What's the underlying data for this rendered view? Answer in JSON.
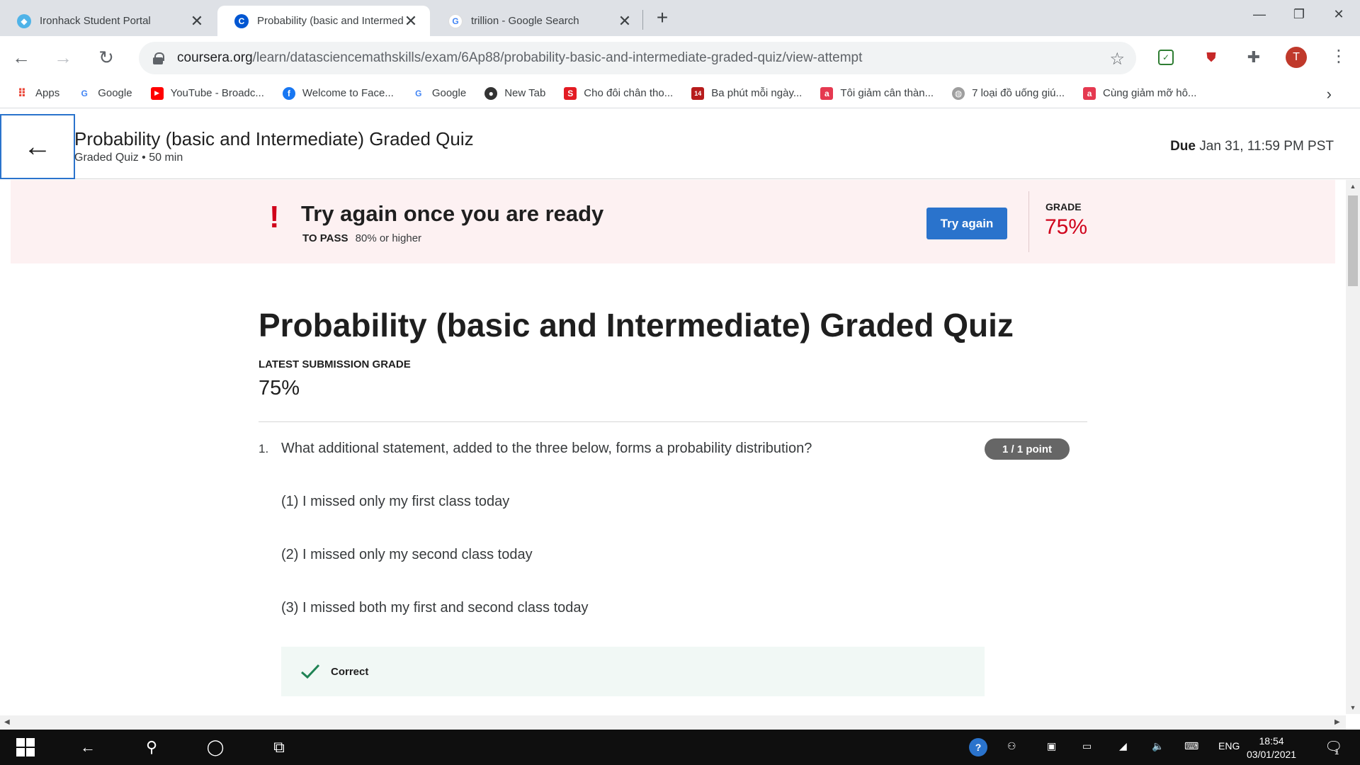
{
  "browser": {
    "tabs": [
      {
        "title": "Ironhack Student Portal",
        "active": false
      },
      {
        "title": "Probability (basic and Intermediate",
        "active": true
      },
      {
        "title": "trillion - Google Search",
        "active": false
      }
    ],
    "url_domain": "coursera.org",
    "url_path": "/learn/datasciencemathskills/exam/6Ap88/probability-basic-and-intermediate-graded-quiz/view-attempt",
    "profile_initial": "T"
  },
  "bookmarks": [
    {
      "label": "Apps",
      "icon": "apps-grid-icon"
    },
    {
      "label": "Google",
      "icon": "google-icon"
    },
    {
      "label": "YouTube - Broadc...",
      "icon": "youtube-icon"
    },
    {
      "label": "Welcome to Face...",
      "icon": "facebook-icon"
    },
    {
      "label": "Google",
      "icon": "google-icon"
    },
    {
      "label": "New Tab",
      "icon": "github-icon"
    },
    {
      "label": "Cho đôi chân tho...",
      "icon": "s-brand-icon"
    },
    {
      "label": "Ba phút mỗi ngày...",
      "icon": "calendar-14-icon"
    },
    {
      "label": "Tôi giảm cân thàn...",
      "icon": "a-brand-icon"
    },
    {
      "label": "7 loại đồ uống giú...",
      "icon": "globe-icon"
    },
    {
      "label": "Cùng giảm mỡ hô...",
      "icon": "a-brand-icon"
    }
  ],
  "header": {
    "title": "Probability (basic and Intermediate) Graded Quiz",
    "subtitle": "Graded Quiz • 50 min",
    "due_label": "Due",
    "due_value": "Jan 31, 11:59 PM PST"
  },
  "banner": {
    "message": "Try again once you are ready",
    "pass_label": "TO PASS",
    "pass_value": "80% or higher",
    "button_label": "Try again",
    "grade_label": "GRADE",
    "grade_value": "75%"
  },
  "main": {
    "title": "Probability (basic and Intermediate) Graded Quiz",
    "latest_grade_label": "LATEST SUBMISSION GRADE",
    "latest_grade_value": "75%",
    "question": {
      "number": "1.",
      "text": "What additional statement, added to the three below, forms a probability distribution?",
      "points": "1 / 1 point",
      "statements": [
        "(1) I missed only my first class today",
        "(2) I missed only my second class today",
        "(3) I missed both my first and second class today"
      ],
      "result": "Correct"
    }
  },
  "taskbar": {
    "language": "ENG",
    "time": "18:54",
    "date": "03/01/2021",
    "notification_count": "1"
  },
  "colors": {
    "accent_blue": "#2a73cc",
    "fail_red": "#d0021b",
    "banner_bg": "#fdf1f2",
    "correct_bg": "#f1f8f5",
    "correct_green": "#1f8354"
  }
}
